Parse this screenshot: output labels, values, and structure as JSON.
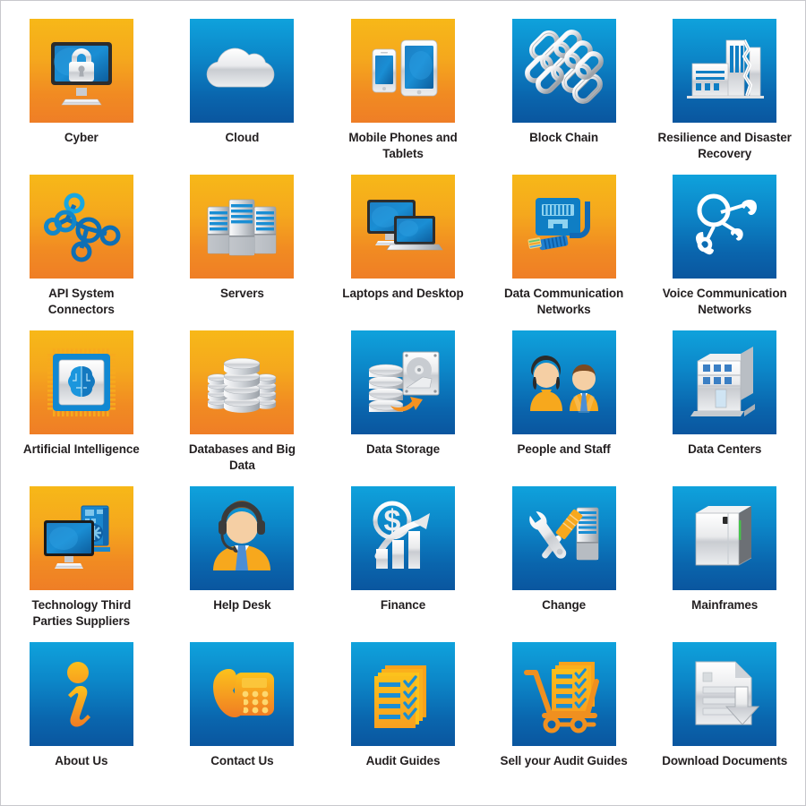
{
  "page": {
    "background": "#ffffff",
    "border_color": "#c8c8cc",
    "label_color": "#231f20",
    "columns": 5,
    "rows": 5
  },
  "palette": {
    "orange_top": "#f7b818",
    "orange_bottom": "#ef7e26",
    "blue_top": "#0fa2dc",
    "blue_bottom": "#0a569f",
    "silver_light": "#f2f2f2",
    "silver_dark": "#9aa0a6",
    "accent_blue": "#0f83cd",
    "accent_orange": "#f7941e"
  },
  "tiles": [
    {
      "label": "Cyber",
      "icon": "monitor-lock-icon",
      "tone": "orange"
    },
    {
      "label": "Cloud",
      "icon": "cloud-icon",
      "tone": "blue"
    },
    {
      "label": "Mobile Phones and Tablets",
      "icon": "phone-tablet-icon",
      "tone": "orange"
    },
    {
      "label": "Block Chain",
      "icon": "chain-links-icon",
      "tone": "blue"
    },
    {
      "label": "Resilience and Disaster Recovery",
      "icon": "broken-buildings-icon",
      "tone": "blue"
    },
    {
      "label": "API System Connectors",
      "icon": "node-network-icon",
      "tone": "orange"
    },
    {
      "label": "Servers",
      "icon": "server-racks-icon",
      "tone": "orange"
    },
    {
      "label": "Laptops and Desktop",
      "icon": "desktop-laptop-icon",
      "tone": "orange"
    },
    {
      "label": "Data Communication Networks",
      "icon": "rj45-port-cable-icon",
      "tone": "orange"
    },
    {
      "label": "Voice Communication Networks",
      "icon": "phone-handset-network-icon",
      "tone": "blue"
    },
    {
      "label": "Artificial Intelligence",
      "icon": "chip-brain-icon",
      "tone": "orange"
    },
    {
      "label": "Databases and Big Data",
      "icon": "database-stacks-icon",
      "tone": "orange"
    },
    {
      "label": "Data Storage",
      "icon": "disk-backup-icon",
      "tone": "blue"
    },
    {
      "label": "People and Staff",
      "icon": "two-people-icon",
      "tone": "blue"
    },
    {
      "label": "Data Centers",
      "icon": "data-center-building-icon",
      "tone": "blue"
    },
    {
      "label": "Technology Third Parties Suppliers",
      "icon": "monitor-hardware-icon",
      "tone": "orange"
    },
    {
      "label": "Help Desk",
      "icon": "headset-agent-icon",
      "tone": "blue"
    },
    {
      "label": "Finance",
      "icon": "dollar-growth-chart-icon",
      "tone": "blue"
    },
    {
      "label": "Change",
      "icon": "wrench-screwdriver-server-icon",
      "tone": "blue"
    },
    {
      "label": "Mainframes",
      "icon": "mainframe-cabinet-icon",
      "tone": "blue"
    },
    {
      "label": "About Us",
      "icon": "info-i-icon",
      "tone": "blue"
    },
    {
      "label": "Contact Us",
      "icon": "desk-telephone-icon",
      "tone": "blue"
    },
    {
      "label": "Audit Guides",
      "icon": "checklist-pages-icon",
      "tone": "blue"
    },
    {
      "label": "Sell your Audit Guides",
      "icon": "cart-checklist-icon",
      "tone": "blue"
    },
    {
      "label": "Download Documents",
      "icon": "document-download-icon",
      "tone": "blue"
    }
  ]
}
